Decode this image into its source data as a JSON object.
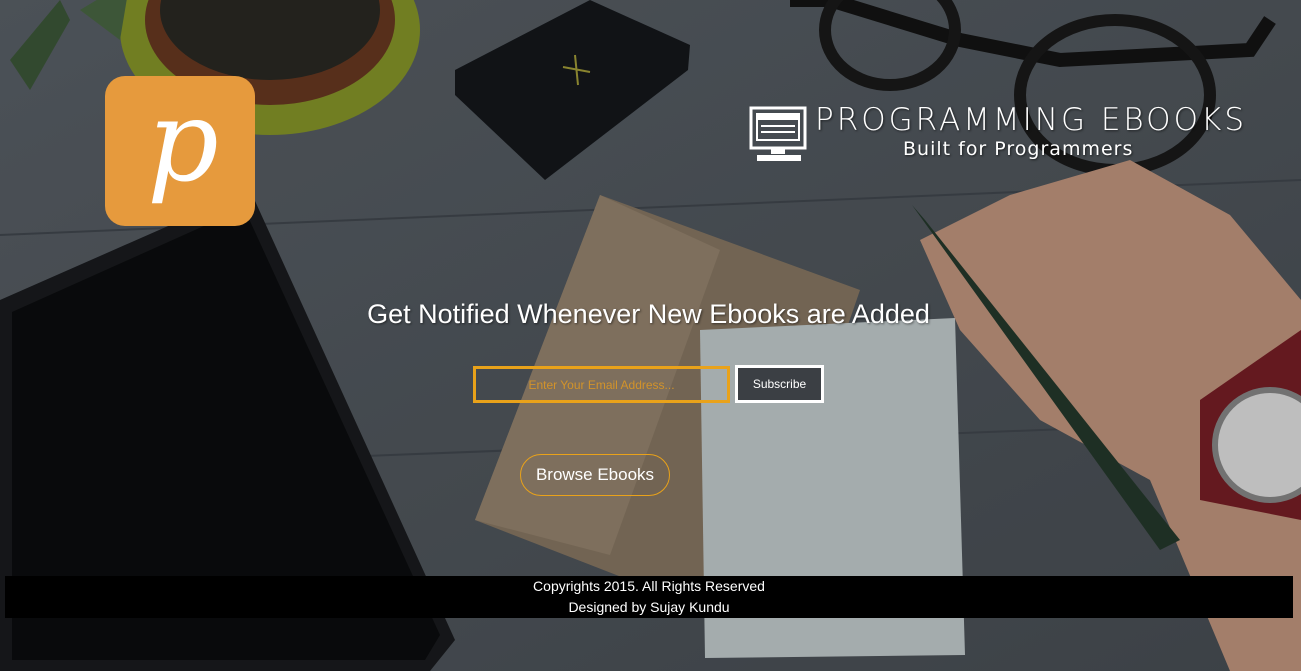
{
  "logo": {
    "letter": "p",
    "color": "#e69a3d"
  },
  "brand": {
    "icon": "monitor-icon",
    "title": "PROGRAMMING EBOOKS",
    "subtitle": "Built for Programmers"
  },
  "headline": "Get Notified Whenever New Ebooks are Added",
  "subscribe": {
    "placeholder": "Enter Your Email Address...",
    "value": "",
    "button_label": "Subscribe",
    "accent": "#e9a21a"
  },
  "browse": {
    "label": "Browse Ebooks"
  },
  "footer": {
    "copyright": "Copyrights 2015. All Rights Reserved",
    "designer": "Designed by Sujay Kundu"
  },
  "colors": {
    "accent": "#e9a21a",
    "logo_bg": "#e69a3d",
    "footer_bg": "#000000"
  }
}
